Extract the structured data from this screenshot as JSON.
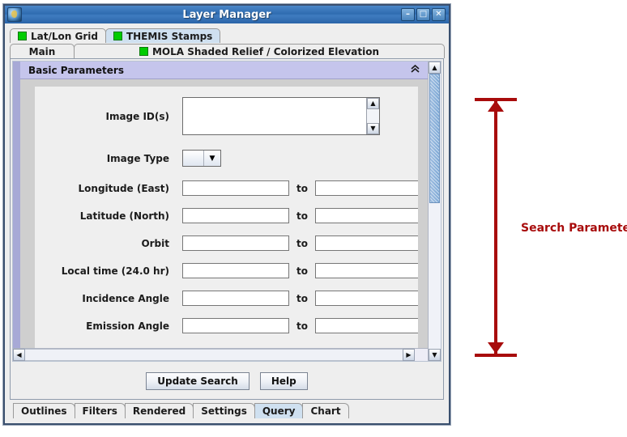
{
  "window": {
    "title": "Layer Manager",
    "app_icon": "globe-icon",
    "controls": {
      "minimize": "–",
      "maximize": "□",
      "close": "✕"
    }
  },
  "tabs_row1": [
    {
      "label": "Lat/Lon Grid",
      "selected": false,
      "swatch": "#00cc00"
    },
    {
      "label": "THEMIS Stamps",
      "selected": true,
      "swatch": "#00cc00"
    }
  ],
  "tabs_row2": [
    {
      "label": "Main",
      "selected": false,
      "swatch": null
    },
    {
      "label": "MOLA Shaded Relief / Colorized Elevation",
      "selected": false,
      "swatch": "#00cc00"
    }
  ],
  "section": {
    "title": "Basic Parameters",
    "collapse_icon": "«"
  },
  "form": {
    "image_ids": {
      "label": "Image ID(s)",
      "value": ""
    },
    "image_type": {
      "label": "Image Type",
      "value": "",
      "arrow": "▼"
    },
    "rows": [
      {
        "label": "Longitude (East)",
        "from": "",
        "to_label": "to",
        "to": ""
      },
      {
        "label": "Latitude (North)",
        "from": "",
        "to_label": "to",
        "to": ""
      },
      {
        "label": "Orbit",
        "from": "",
        "to_label": "to",
        "to": ""
      },
      {
        "label": "Local time (24.0 hr)",
        "from": "",
        "to_label": "to",
        "to": ""
      },
      {
        "label": "Incidence Angle",
        "from": "",
        "to_label": "to",
        "to": ""
      },
      {
        "label": "Emission Angle",
        "from": "",
        "to_label": "to",
        "to": ""
      }
    ]
  },
  "scrollbars": {
    "up_arrow": "▲",
    "down_arrow": "▼",
    "left_arrow": "◀",
    "right_arrow": "▶"
  },
  "buttons": {
    "update_search": "Update Search",
    "help": "Help"
  },
  "bottom_tabs": [
    {
      "label": "Outlines",
      "selected": false
    },
    {
      "label": "Filters",
      "selected": false
    },
    {
      "label": "Rendered",
      "selected": false
    },
    {
      "label": "Settings",
      "selected": false
    },
    {
      "label": "Query",
      "selected": true
    },
    {
      "label": "Chart",
      "selected": false
    }
  ],
  "annotation": {
    "label": "Search Parameters",
    "color": "#a80c0c"
  }
}
